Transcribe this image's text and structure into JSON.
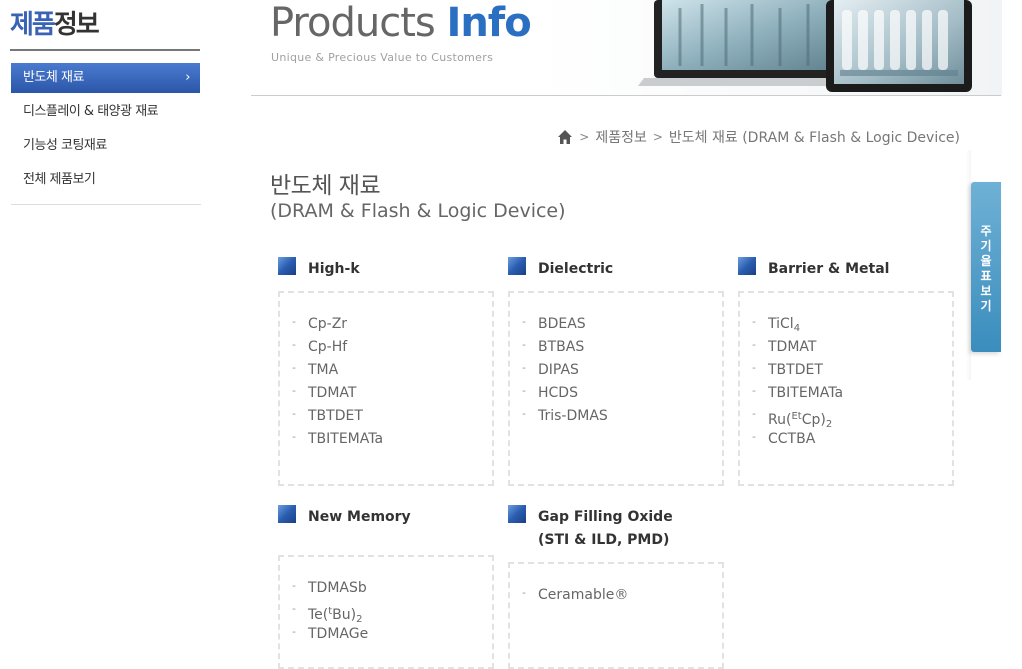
{
  "sidebar": {
    "title_part1": "제품",
    "title_part2": "정보",
    "items": [
      {
        "label": "반도체 재료",
        "active": true
      },
      {
        "label": "디스플레이 & 태양광 재료"
      },
      {
        "label": "기능성 코팅재료"
      },
      {
        "label": "전체 제품보기"
      }
    ],
    "chevron": "›"
  },
  "banner": {
    "title_part1": "Products ",
    "title_part2": "Info",
    "subtitle": "Unique & Precious Value to Customers"
  },
  "breadcrumb": {
    "icon": "home-icon",
    "sep": ">",
    "level1": "제품정보",
    "level2": "반도체 재료 (DRAM & Flash & Logic Device)"
  },
  "page": {
    "title": "반도체 재료",
    "subtitle": "(DRAM & Flash & Logic Device)"
  },
  "side_tab": {
    "label_chars": [
      "주",
      "기",
      "율",
      "표",
      "보",
      "기"
    ]
  },
  "categories": [
    {
      "title": "High-k",
      "items": [
        "Cp-Zr",
        "Cp-Hf",
        "TMA",
        "TDMAT",
        "TBTDET",
        "TBITEMATa"
      ]
    },
    {
      "title": "Dielectric",
      "items": [
        "BDEAS",
        "BTBAS",
        "DIPAS",
        "HCDS",
        "Tris-DMAS"
      ]
    },
    {
      "title": "Barrier & Metal",
      "items": [
        {
          "base": "TiCl",
          "sub": "4"
        },
        "TDMAT",
        "TBTDET",
        "TBITEMATa",
        {
          "pre": "Ru(",
          "sup": "Et",
          "mid": "Cp)",
          "sub": "2"
        },
        "CCTBA"
      ]
    },
    {
      "title": "New Memory",
      "items": [
        "TDMASb",
        {
          "pre": "Te(",
          "sup": "t",
          "mid": "Bu)",
          "sub": "2"
        },
        "TDMAGe"
      ]
    },
    {
      "title_line1": "Gap Filling Oxide",
      "title_line2": "(STI & ILD, PMD)",
      "items": [
        "Ceramable®"
      ]
    }
  ],
  "colors": {
    "accent_blue": "#2a6fc1",
    "menu_active": "#3a63b5",
    "side_tab": "#3a8dbd"
  }
}
